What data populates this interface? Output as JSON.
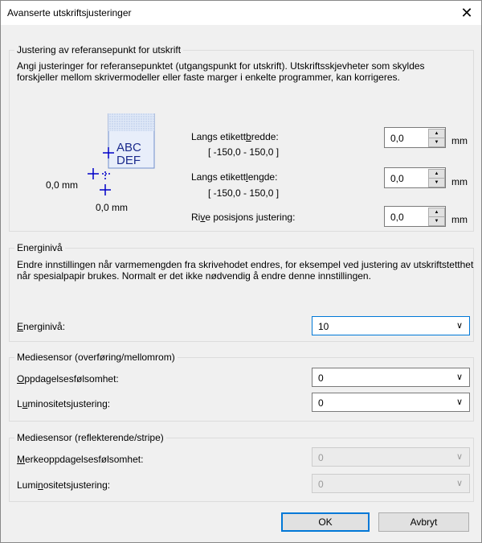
{
  "window": {
    "title": "Avanserte utskriftsjusteringer",
    "close_glyph": "✕"
  },
  "reference": {
    "legend": "Justering av referansepunkt for utskrift",
    "description": "Angi justeringer for referansepunktet (utgangspunkt for utskrift). Utskriftsskjevheter som skyldes forskjeller mellom skrivermodeller eller faste marger i enkelte programmer, kan korrigeres.",
    "diagram": {
      "text_line1": "ABC",
      "text_line2": "DEF",
      "x_label": "0,0 mm",
      "y_label": "0,0 mm"
    },
    "width": {
      "label_pre": "Langs etikett",
      "label_ul": "b",
      "label_post": "redde:",
      "range": "[ -150,0 - 150,0 ]",
      "value": "0,0",
      "unit": "mm"
    },
    "length": {
      "label_pre": "Langs etikett",
      "label_ul": "l",
      "label_post": "engde:",
      "range": "[ -150,0 - 150,0 ]",
      "value": "0,0",
      "unit": "mm"
    },
    "tear": {
      "label_pre": "Ri",
      "label_ul": "v",
      "label_post": "e posisjons justering:",
      "value": "0,0",
      "unit": "mm"
    }
  },
  "energy": {
    "legend": "Energinivå",
    "description": "Endre innstillingen når varmemengden fra skrivehodet endres, for eksempel ved justering av utskriftstetthet når spesialpapir brukes. Normalt er det ikke nødvendig å endre denne innstillingen.",
    "label_ul": "E",
    "label_post": "nerginivå:",
    "value": "10"
  },
  "media_trans": {
    "legend": "Mediesensor (overføring/mellomrom)",
    "detect_ul": "O",
    "detect_post": "ppdagelsesfølsomhet:",
    "detect_value": "0",
    "lum_pre": "L",
    "lum_ul": "u",
    "lum_post": "minositetsjustering:",
    "lum_value": "0"
  },
  "media_refl": {
    "legend": "Mediesensor (reflekterende/stripe)",
    "detect_ul": "M",
    "detect_post": "erkeoppdagelsesfølsomhet:",
    "detect_value": "0",
    "lum_pre": "Lumi",
    "lum_ul": "n",
    "lum_post": "ositetsjustering:",
    "lum_value": "0"
  },
  "buttons": {
    "ok": "OK",
    "cancel": "Avbryt"
  },
  "colors": {
    "accent": "#0078d7",
    "diagram_label": "#c8d6f0",
    "arrow": "#0000c8"
  }
}
